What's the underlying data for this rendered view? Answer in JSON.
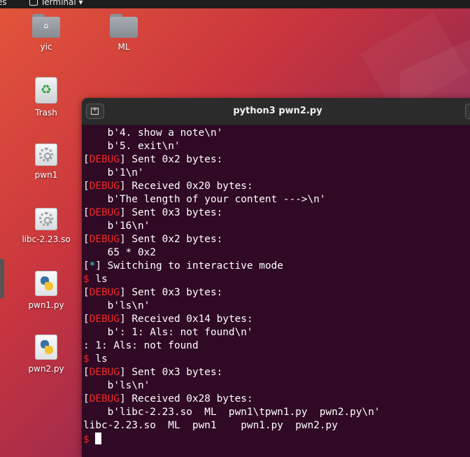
{
  "topbar": {
    "activities": "es",
    "app_name": "Terminal ▾"
  },
  "desktop": {
    "icons": [
      {
        "label": "yic",
        "kind": "home-folder"
      },
      {
        "label": "ML",
        "kind": "folder"
      },
      {
        "label": "Trash",
        "kind": "trash"
      },
      {
        "label": "pwn1",
        "kind": "executable"
      },
      {
        "label": "libc-2.23.so",
        "kind": "library"
      },
      {
        "label": "pwn1.py",
        "kind": "python"
      },
      {
        "label": "pwn2.py",
        "kind": "python"
      }
    ]
  },
  "terminal": {
    "title": "python3 pwn2.py",
    "lines": [
      {
        "text": "    b'4. show a note\\n'"
      },
      {
        "text": "    b'5. exit\\n'"
      },
      {
        "tag": "DEBUG",
        "text": " Sent 0x2 bytes:"
      },
      {
        "text": "    b'1\\n'"
      },
      {
        "tag": "DEBUG",
        "text": " Received 0x20 bytes:"
      },
      {
        "text": "    b'The length of your content --->\\n'"
      },
      {
        "tag": "DEBUG",
        "text": " Sent 0x3 bytes:"
      },
      {
        "text": "    b'16\\n'"
      },
      {
        "tag": "DEBUG",
        "text": " Sent 0x2 bytes:"
      },
      {
        "text": "    65 * 0x2"
      },
      {
        "star": "*",
        "text": " Switching to interactive mode"
      },
      {
        "prompt": "$",
        "text": " ls"
      },
      {
        "tag": "DEBUG",
        "text": " Sent 0x3 bytes:"
      },
      {
        "text": "    b'ls\\n'"
      },
      {
        "tag": "DEBUG",
        "text": " Received 0x14 bytes:"
      },
      {
        "text": "    b': 1: Als: not found\\n'"
      },
      {
        "text": ": 1: Als: not found"
      },
      {
        "prompt": "$",
        "text": " ls"
      },
      {
        "tag": "DEBUG",
        "text": " Sent 0x3 bytes:"
      },
      {
        "text": "    b'ls\\n'"
      },
      {
        "tag": "DEBUG",
        "text": " Received 0x28 bytes:"
      },
      {
        "text": "    b'libc-2.23.so  ML  pwn1\\tpwn1.py  pwn2.py\\n'"
      },
      {
        "text": "libc-2.23.so  ML  pwn1    pwn1.py  pwn2.py"
      }
    ],
    "final_prompt": "$"
  },
  "colors": {
    "terminal_bg": "#300a24",
    "debug_red": "#ef2929",
    "info_cyan": "#34e2e2"
  }
}
